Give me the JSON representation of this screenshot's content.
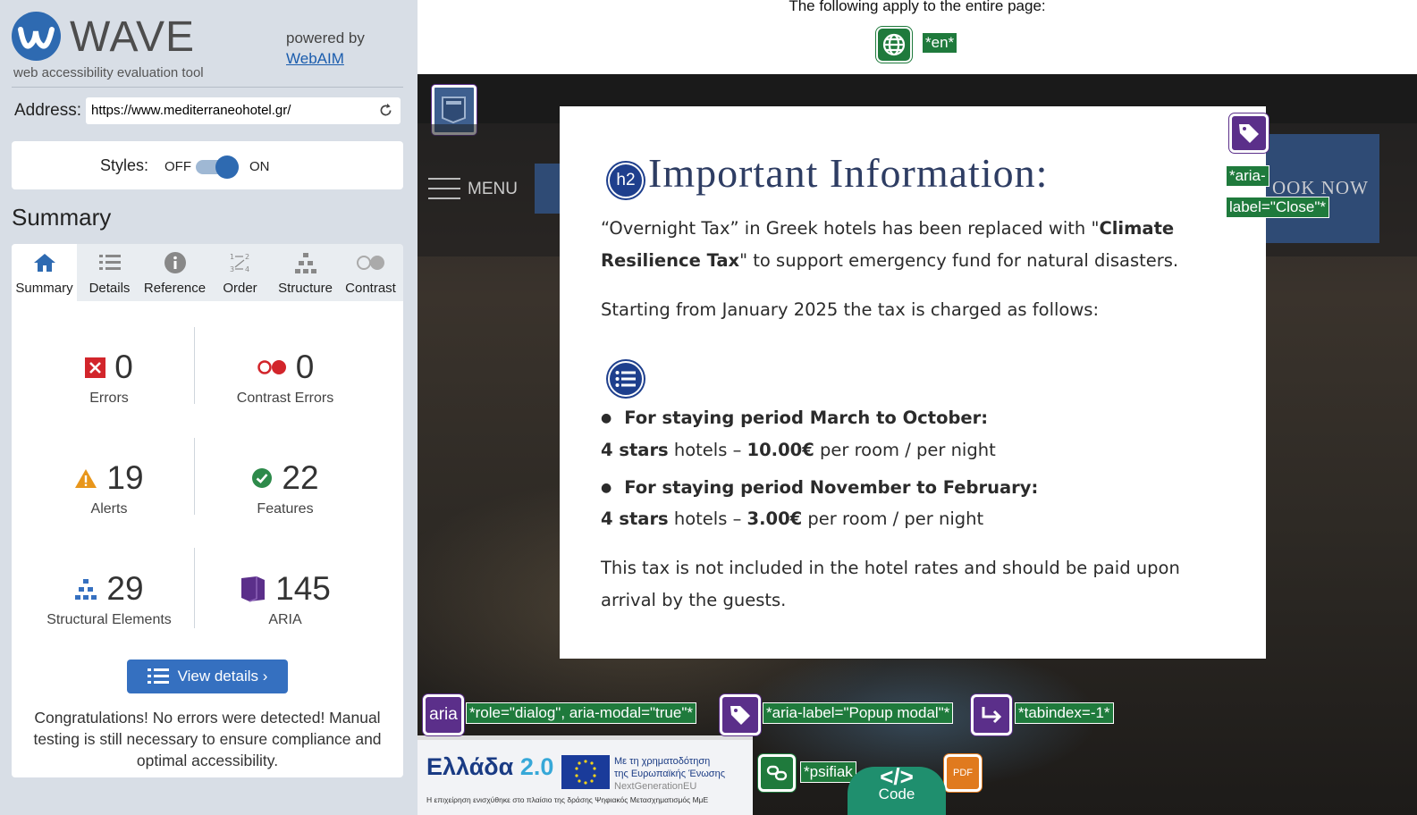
{
  "wave": {
    "logo_word": "WAVE",
    "logo_sub": "web accessibility evaluation tool",
    "powered_by": "powered by",
    "webaim_link": "WebAIM",
    "address_label": "Address:",
    "address_value": "https://www.mediterraneohotel.gr/",
    "styles_label": "Styles:",
    "styles_off": "OFF",
    "styles_on": "ON",
    "summary_heading": "Summary",
    "tabs": [
      {
        "label": "Summary",
        "icon": "home-icon"
      },
      {
        "label": "Details",
        "icon": "list-icon"
      },
      {
        "label": "Reference",
        "icon": "info-icon"
      },
      {
        "label": "Order",
        "icon": "order-icon"
      },
      {
        "label": "Structure",
        "icon": "structure-icon"
      },
      {
        "label": "Contrast",
        "icon": "contrast-icon"
      }
    ],
    "stats": {
      "errors": {
        "value": "0",
        "label": "Errors"
      },
      "contrast": {
        "value": "0",
        "label": "Contrast Errors"
      },
      "alerts": {
        "value": "19",
        "label": "Alerts"
      },
      "features": {
        "value": "22",
        "label": "Features"
      },
      "structural": {
        "value": "29",
        "label": "Structural Elements"
      },
      "aria": {
        "value": "145",
        "label": "ARIA"
      }
    },
    "view_details": "View details ›",
    "congrats": "Congratulations! No errors were detected! Manual testing is still necessary to ensure compliance and optimal accessibility."
  },
  "page": {
    "apply_text": "The following apply to the entire page:",
    "lang_tag": "*en*",
    "menu": "MENU",
    "book_now": "OOK NOW",
    "close_tag_1": "*aria-",
    "close_tag_2": "label=\"Close\"*",
    "role_tag": "*role=\"dialog\", aria-modal=\"true\"*",
    "aria_label_tag": "*aria-label=\"Popup modal\"*",
    "tabindex_tag": "*tabindex=-1*",
    "psifiaki_tag": "*psifiak",
    "aria_icon_text": "aria",
    "code_label": "Code",
    "code_symbol": "</>",
    "pdf_label": "PDF",
    "banner": {
      "ellada": "Ελλάδα",
      "version": "2.0",
      "line1": "Με τη χρηματοδότηση",
      "line2": "της Ευρωπαϊκής Ένωσης",
      "line3": "NextGenerationEU",
      "small": "Η επιχείρηση ενισχύθηκε στο πλαίσιο της δράσης Ψηφιακός Μετασχηματισμός ΜμΕ"
    }
  },
  "modal": {
    "h2_badge": "h2",
    "title": "Important Information:",
    "p1_a": "“Overnight Tax” in Greek hotels has been replaced with \"",
    "p1_b": "Climate Resilience Tax",
    "p1_c": "\" to support emergency fund for natural disasters.",
    "p2": "Starting from January 2025 the tax is charged as follows:",
    "bullet1": "For staying period March to October:",
    "line1_a": "4 stars",
    "line1_b": " hotels – ",
    "line1_c": "10.00€",
    "line1_d": " per room / per night",
    "bullet2": "For staying period November to February:",
    "line2_a": "4 stars",
    "line2_b": " hotels – ",
    "line2_c": "3.00€",
    "line2_d": " per room / per night",
    "p3": "This tax is not included in the hotel rates and should be paid upon arrival by the guests."
  }
}
